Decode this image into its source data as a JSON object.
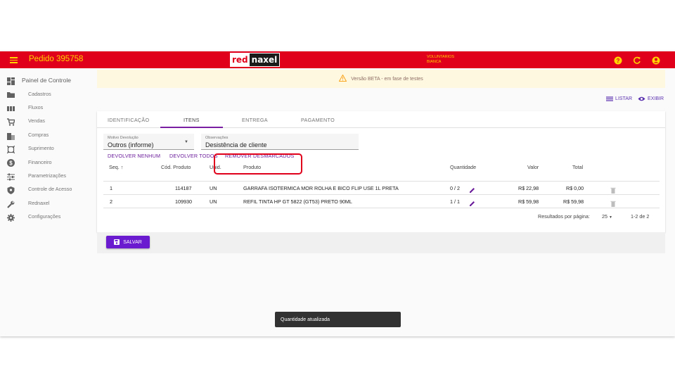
{
  "header": {
    "title": "Pedido 395758",
    "logo_red": "red",
    "logo_rest": "naxel",
    "user_line1": "VOLUNTARIOS",
    "user_line2": "BIANCA",
    "brand_color": "#e0001b",
    "accent_color": "#ffd400"
  },
  "sidebar": {
    "items": [
      {
        "label": "Painel de Controle",
        "icon": "dashboard-icon"
      },
      {
        "label": "Cadastros",
        "icon": "folder-icon"
      },
      {
        "label": "Fluxos",
        "icon": "columns-icon"
      },
      {
        "label": "Vendas",
        "icon": "cart-icon"
      },
      {
        "label": "Compras",
        "icon": "building-icon"
      },
      {
        "label": "Suprimento",
        "icon": "box-icon"
      },
      {
        "label": "Financeiro",
        "icon": "dollar-icon"
      },
      {
        "label": "Parametrizações",
        "icon": "sliders-icon"
      },
      {
        "label": "Controle de Acesso",
        "icon": "shield-icon"
      },
      {
        "label": "Rednaxel",
        "icon": "wrench-icon"
      },
      {
        "label": "Configurações",
        "icon": "gear-icon"
      }
    ]
  },
  "banner": {
    "text": "Versão BETA - em fase de testes"
  },
  "view_links": {
    "list": "LISTAR",
    "show": "EXIBIR"
  },
  "tabs": [
    "IDENTIFICAÇÃO",
    "ITENS",
    "ENTREGA",
    "PAGAMENTO"
  ],
  "form": {
    "reason_label": "Motivo Devolução",
    "reason_value": "Outros (informe)",
    "notes_label": "Observações",
    "notes_value": "Desistência de cliente"
  },
  "actions": {
    "return_none": "DEVOLVER NENHUM",
    "return_all": "DEVOLVER TODOS",
    "remove_unmarked": "REMOVER DESMARCADOS"
  },
  "table": {
    "headers": {
      "seq": "Seq.",
      "code": "Cód. Produto",
      "unit": "Unid.",
      "product": "Produto",
      "qty": "Quantidade",
      "value": "Valor",
      "total": "Total"
    },
    "sort_arrow": "↑",
    "rows": [
      {
        "seq": "1",
        "code": "114187",
        "unit": "UN",
        "product": "GARRAFA ISOTERMICA MOR ROLHA E BICO FLIP USE 1L PRETA",
        "qty": "0 / 2",
        "value": "R$ 22,98",
        "total": "R$ 0,00"
      },
      {
        "seq": "2",
        "code": "109930",
        "unit": "UN",
        "product": "REFIL TINTA HP GT 5822 (GT53) PRETO 90ML",
        "qty": "1 / 1",
        "value": "R$ 59,98",
        "total": "R$ 59,98"
      }
    ]
  },
  "pagination": {
    "label": "Resultados por página:",
    "per_page": "25",
    "range": "1-2 de 2"
  },
  "save_button": "SALVAR",
  "snackbar": "Quantidade atualizada"
}
